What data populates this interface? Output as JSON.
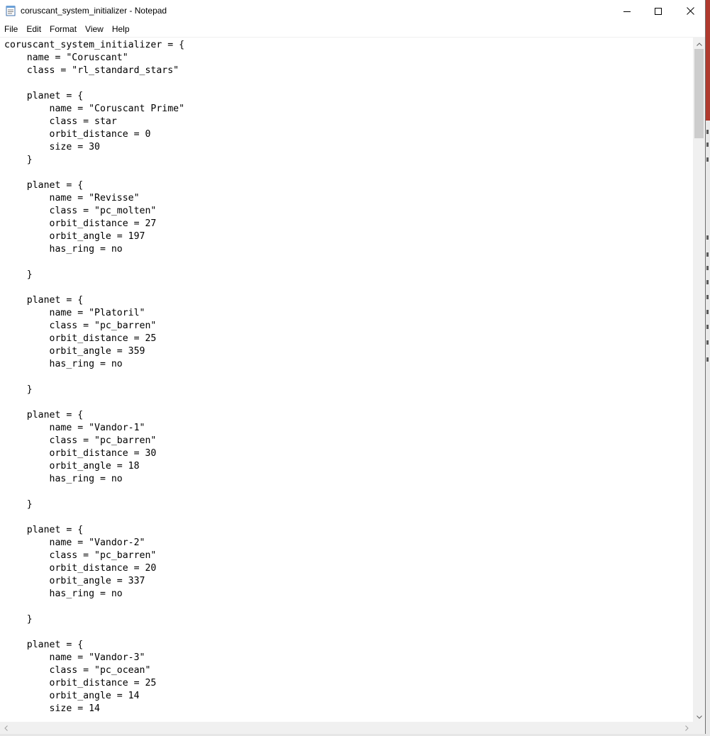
{
  "window": {
    "title": "coruscant_system_initializer - Notepad",
    "app_icon": "notepad-icon",
    "caption_buttons": [
      "minimize-icon",
      "maximize-icon",
      "close-icon"
    ]
  },
  "menu": {
    "items": [
      "File",
      "Edit",
      "Format",
      "View",
      "Help"
    ]
  },
  "editor": {
    "lines": [
      "coruscant_system_initializer = {",
      "    name = \"Coruscant\"",
      "    class = \"rl_standard_stars\"",
      "",
      "    planet = {",
      "        name = \"Coruscant Prime\"",
      "        class = star",
      "        orbit_distance = 0",
      "        size = 30",
      "    }",
      "",
      "    planet = {",
      "        name = \"Revisse\"",
      "        class = \"pc_molten\"",
      "        orbit_distance = 27",
      "        orbit_angle = 197",
      "        has_ring = no",
      "",
      "    }",
      "",
      "    planet = {",
      "        name = \"Platoril\"",
      "        class = \"pc_barren\"",
      "        orbit_distance = 25",
      "        orbit_angle = 359",
      "        has_ring = no",
      "",
      "    }",
      "",
      "    planet = {",
      "        name = \"Vandor-1\"",
      "        class = \"pc_barren\"",
      "        orbit_distance = 30",
      "        orbit_angle = 18",
      "        has_ring = no",
      "",
      "    }",
      "",
      "    planet = {",
      "        name = \"Vandor-2\"",
      "        class = \"pc_barren\"",
      "        orbit_distance = 20",
      "        orbit_angle = 337",
      "        has_ring = no",
      "",
      "    }",
      "",
      "    planet = {",
      "        name = \"Vandor-3\"",
      "        class = \"pc_ocean\"",
      "        orbit_distance = 25",
      "        orbit_angle = 14",
      "        size = 14"
    ]
  },
  "scrollbars": {
    "vertical_position": 0.0
  }
}
